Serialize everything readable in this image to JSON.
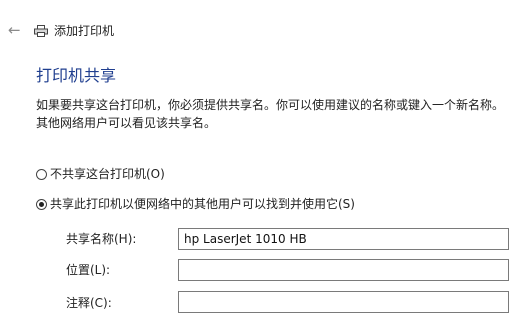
{
  "window": {
    "title": "添加打印机"
  },
  "section": {
    "title": "打印机共享",
    "description": "如果要共享这台打印机，你必须提供共享名。你可以使用建议的名称或键入一个新名称。其他网络用户可以看见该共享名。"
  },
  "options": [
    {
      "label": "不共享这台打印机(O)",
      "selected": false
    },
    {
      "label": "共享此打印机以便网络中的其他用户可以找到并使用它(S)",
      "selected": true
    }
  ],
  "fields": {
    "share_name": {
      "label": "共享名称(H):",
      "value": "hp LaserJet 1010 HB"
    },
    "location": {
      "label": "位置(L):",
      "value": ""
    },
    "comment": {
      "label": "注释(C):",
      "value": ""
    }
  },
  "icons": {
    "back": "back-arrow-icon",
    "printer": "printer-icon"
  }
}
